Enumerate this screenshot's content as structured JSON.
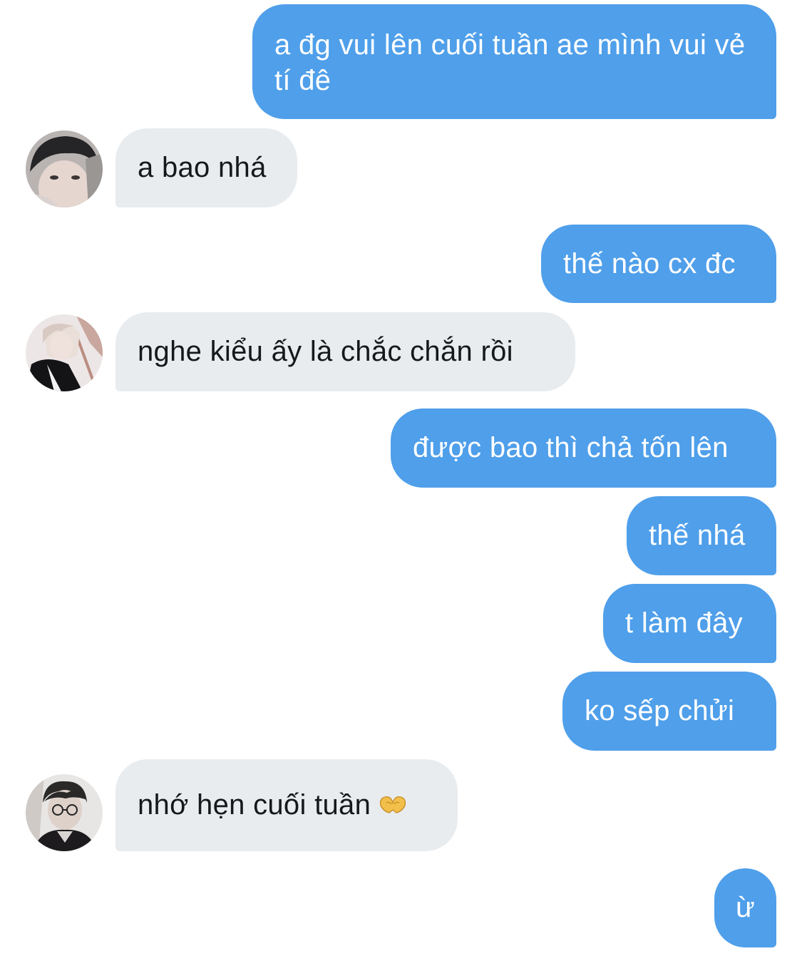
{
  "conversation": {
    "messages": [
      {
        "sender": "me",
        "text": "a đg vui lên cuối tuần ae mình vui vẻ tí đê"
      },
      {
        "sender": "them",
        "text": "a bao nhá",
        "avatar_icon": "profile-photo-icon"
      },
      {
        "sender": "me",
        "text": "thế nào cx đc"
      },
      {
        "sender": "them",
        "text": "nghe kiểu ấy là chắc chắn rồi",
        "avatar_icon": "profile-photo-icon"
      },
      {
        "sender": "me",
        "text": "được bao thì chả tốn lên"
      },
      {
        "sender": "me",
        "text": "thế nhá"
      },
      {
        "sender": "me",
        "text": "t làm đây"
      },
      {
        "sender": "me",
        "text": "ko sếp chửi"
      },
      {
        "sender": "them",
        "text": "nhớ hẹn cuối tuần",
        "emoji": "heart-hands-emoji",
        "avatar_icon": "profile-photo-icon"
      },
      {
        "sender": "me",
        "text": "ừ"
      }
    ]
  },
  "colors": {
    "sent_bubble": "#4f9fea",
    "received_bubble": "#e9ecef",
    "sent_text": "#ffffff",
    "received_text": "#16181c"
  }
}
